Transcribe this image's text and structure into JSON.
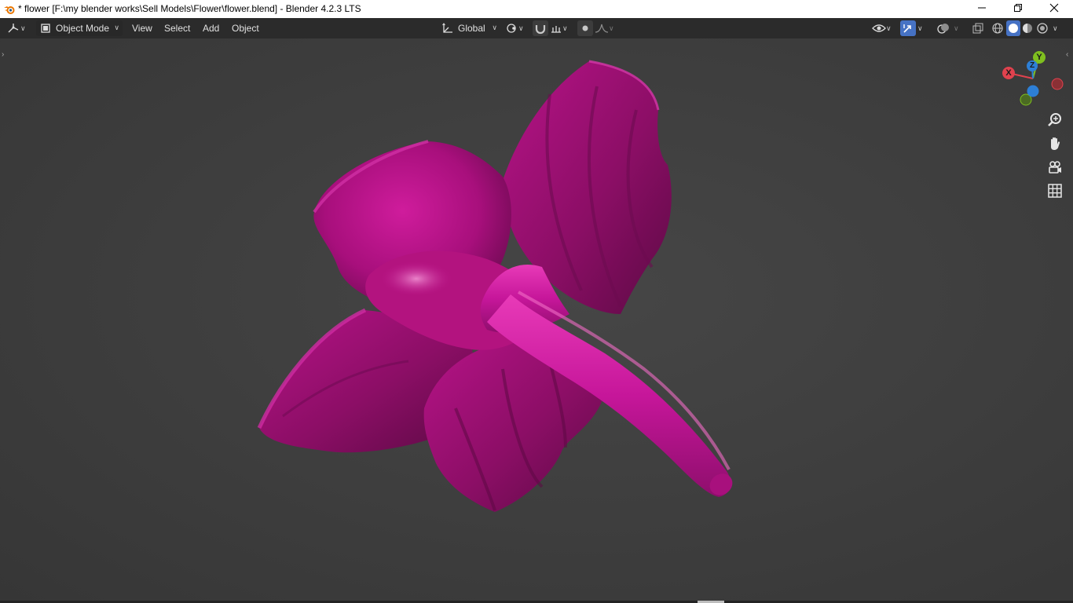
{
  "window": {
    "title": "* flower [F:\\my blender works\\Sell Models\\Flower\\flower.blend] - Blender 4.2.3 LTS",
    "icons": [
      "blender-logo-icon",
      "minimize-icon",
      "restore-icon",
      "close-icon"
    ]
  },
  "header": {
    "mode_label": "Object Mode",
    "menus": {
      "view": "View",
      "select": "Select",
      "add": "Add",
      "object": "Object"
    },
    "transform_orientation": "Global"
  },
  "colors": {
    "flower": "#c0168f",
    "axis_x": "#e0424e",
    "axis_y": "#7fbf1f",
    "axis_z": "#2d7fd6",
    "active_button": "#4672c4"
  },
  "gizmo": {
    "x_label": "X",
    "y_label": "Y",
    "z_label": "Z"
  }
}
